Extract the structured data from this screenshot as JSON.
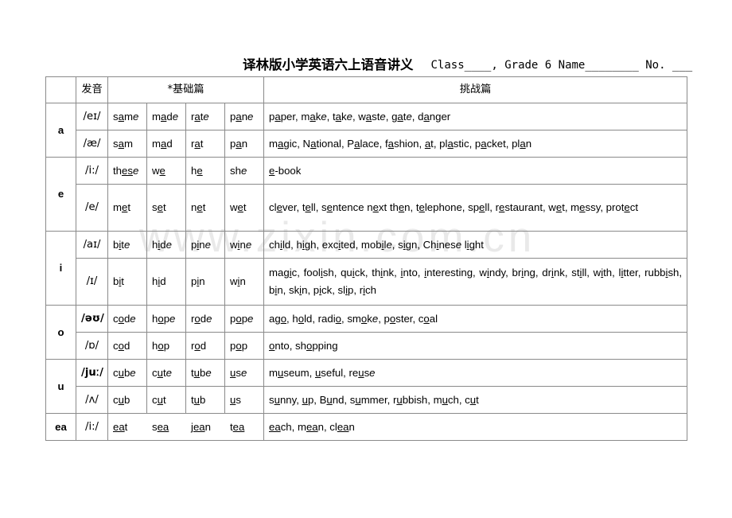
{
  "header": {
    "title_cn": "译林版小学英语六上语音讲义",
    "fields": "Class____, Grade 6 Name________ No. ___"
  },
  "watermark": "www.zixin.com.cn",
  "table": {
    "columns": {
      "letter": "",
      "ipa": "发音",
      "basic": "*基础篇",
      "challenge": "挑战篇"
    },
    "groups": [
      {
        "letter": "a",
        "rows": [
          {
            "ipa": "/eɪ/",
            "ipa_bold": false,
            "words": [
              "same",
              "made",
              "rate",
              "pane"
            ],
            "challenge": "paper, make, take, waste, gate, danger"
          },
          {
            "ipa": "/æ/",
            "ipa_bold": false,
            "words": [
              "sam",
              "mad",
              "rat",
              "pan"
            ],
            "challenge": "magic, National, Palace, fashion, at, plastic, packet, plan"
          }
        ]
      },
      {
        "letter": "e",
        "rows": [
          {
            "ipa": "/i:/",
            "ipa_bold": false,
            "words": [
              "these",
              "we",
              "he",
              "she"
            ],
            "challenge": "e-book"
          },
          {
            "ipa": "/e/",
            "ipa_bold": false,
            "words": [
              "met",
              "set",
              "net",
              "wet"
            ],
            "challenge": "clever, tell, sentence next then, telephone, spell, restaurant, wet, messy, protect"
          }
        ]
      },
      {
        "letter": "i",
        "rows": [
          {
            "ipa": "/aɪ/",
            "ipa_bold": false,
            "words": [
              "bite",
              "hide",
              "pine",
              "wine"
            ],
            "challenge": "child, high, excited, mobile, sign, Chinese light"
          },
          {
            "ipa": "/ɪ/",
            "ipa_bold": false,
            "words": [
              "bit",
              "hid",
              "pin",
              "win"
            ],
            "challenge": "magic, foolish, quick, think, into, interesting, windy, bring, drink, still, with, litter, rubbish, bin, skin, pick, slip, rich"
          }
        ]
      },
      {
        "letter": "o",
        "rows": [
          {
            "ipa": "/əʊ/",
            "ipa_bold": true,
            "words": [
              "code",
              "hope",
              "rode",
              "pope"
            ],
            "challenge": "ago, hold, radio, smoke, poster, coal"
          },
          {
            "ipa": "/ɒ/",
            "ipa_bold": false,
            "words": [
              "cod",
              "hop",
              "rod",
              "pop"
            ],
            "challenge": "onto, shopping"
          }
        ]
      },
      {
        "letter": "u",
        "rows": [
          {
            "ipa": "/juː/",
            "ipa_bold": true,
            "words": [
              "cube",
              "cute",
              "tube",
              "use"
            ],
            "challenge": "museum, useful, reuse"
          },
          {
            "ipa": "/ʌ/",
            "ipa_bold": false,
            "words": [
              "cub",
              "cut",
              "tub",
              "us"
            ],
            "challenge": "sunny, up, Bund, summer, rubbish, much, cut"
          }
        ]
      },
      {
        "letter": "ea",
        "rows": [
          {
            "ipa": "/i:/",
            "ipa_bold": false,
            "words": [
              "eat",
              "sea",
              "jean",
              "tea"
            ],
            "challenge": "each, mean, clean"
          }
        ]
      }
    ]
  }
}
